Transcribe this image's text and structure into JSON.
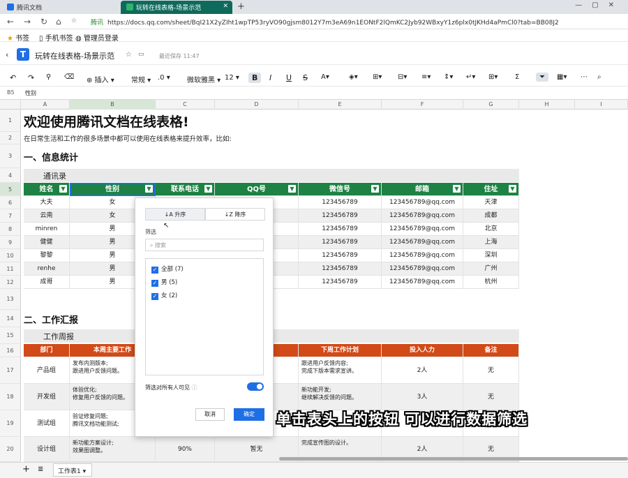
{
  "browser": {
    "tabs": [
      {
        "label": "腾讯文档"
      },
      {
        "label": "玩转在线表格-场景示范"
      }
    ],
    "new_tab": "+",
    "site_badge": "腾讯",
    "url": "https://docs.qq.com/sheet/BqI21X2yZIht1wpTP53ryVO90gjsm8012Y7m3eA69n1EONtF2lQmKC2Jyb92WBxyY1z6plx0tJKHd4aPmCl0?tab=BB08J2",
    "bookmarks": [
      "书签",
      "手机书签",
      "管理员登录"
    ]
  },
  "doc": {
    "title": "玩转在线表格-场景示范",
    "save_status": "最近保存 11:47"
  },
  "toolbar": {
    "insert": "插入",
    "format": "常规",
    "decimal": ".0",
    "font": "微软雅黑",
    "size": "12",
    "bold": "B",
    "italic": "I",
    "underline": "U",
    "strike": "S",
    "sum": "Σ"
  },
  "formula_bar": {
    "ref": "B5",
    "content": "性别"
  },
  "columns": [
    "A",
    "B",
    "C",
    "D",
    "E",
    "F",
    "G",
    "H",
    "I"
  ],
  "rows": [
    "1",
    "2",
    "3",
    "4",
    "5",
    "6",
    "7",
    "8",
    "9",
    "10",
    "11",
    "12",
    "13",
    "14",
    "15",
    "16",
    "17",
    "18",
    "19",
    "20"
  ],
  "sheet": {
    "title": "欢迎使用腾讯文档在线表格!",
    "subtitle": "在日常生活和工作的很多场景中都可以使用在线表格来提升效率，比如:",
    "section1": "一、信息统计",
    "band1": "通讯录",
    "contact_headers": [
      "姓名",
      "性别",
      "联系电话",
      "QQ号",
      "微信号",
      "邮箱",
      "住址"
    ],
    "contacts": [
      [
        "大夫",
        "女",
        "",
        "",
        "123456789",
        "123456789@qq.com",
        "天津"
      ],
      [
        "云南",
        "女",
        "",
        "",
        "123456789",
        "123456789@qq.com",
        "成都"
      ],
      [
        "minren",
        "男",
        "",
        "",
        "123456789",
        "123456789@qq.com",
        "北京"
      ],
      [
        "健健",
        "男",
        "",
        "",
        "123456789",
        "123456789@qq.com",
        "上海"
      ],
      [
        "黎黎",
        "男",
        "",
        "",
        "123456789",
        "123456789@qq.com",
        "深圳"
      ],
      [
        "renhe",
        "男",
        "",
        "",
        "123456789",
        "123456789@qq.com",
        "广州"
      ],
      [
        "成哥",
        "男",
        "",
        "",
        "123456789",
        "123456789@qq.com",
        "杭州"
      ]
    ],
    "section2": "二、工作汇报",
    "band2": "工作周报",
    "report_headers": [
      "部门",
      "本周主要工作",
      "",
      "",
      "下周工作计划",
      "投入人力",
      "备注"
    ],
    "reports": [
      {
        "dept": "产品组",
        "work": "发布内测版本;\n跟进用户反馈问题。",
        "plan": "跟进用户反馈内容;\n完成下版本需求宣讲。",
        "people": "2人",
        "note": "无"
      },
      {
        "dept": "开发组",
        "work": "体验优化;\n修复用户反馈的问题。",
        "plan": "新功能开发;\n继续解决反馈的问题。",
        "people": "3人",
        "note": "无"
      },
      {
        "dept": "测试组",
        "work": "验证修复问题;\n腾讯文档功能测试;",
        "plan": "",
        "people": "",
        "note": ""
      },
      {
        "dept": "设计组",
        "work": "新功能方案设计;\n效果图调整。",
        "progress": "90%",
        "status": "暂无",
        "plan": "完成宣传图的设计。",
        "people": "2人",
        "note": "无"
      }
    ]
  },
  "filter_popup": {
    "sort_asc": "升序",
    "sort_desc": "降序",
    "filter_label": "筛选",
    "search_placeholder": "搜索",
    "options": [
      "全部 (7)",
      "男 (5)",
      "女 (2)"
    ],
    "visible_to_all": "筛选对所有人可见",
    "cancel": "取消",
    "confirm": "确定"
  },
  "caption": "单击表头上的按钮 可以进行数据筛选",
  "sheet_tab": "工作表1",
  "colors": {
    "header_green": "#1d8244",
    "header_orange": "#d24a18",
    "accent_blue": "#1e6fe6"
  }
}
